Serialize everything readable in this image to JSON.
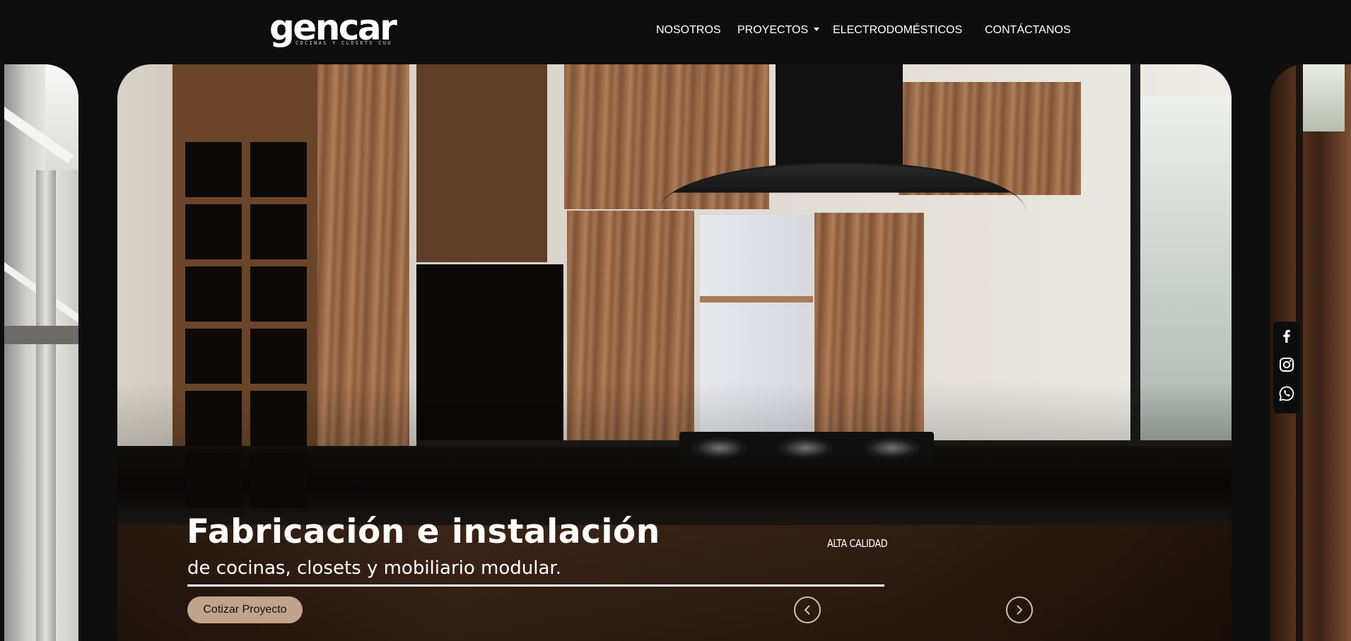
{
  "brand": {
    "logo_text": "gencar",
    "logo_tagline": "COCINAS Y CLOSETS CUU"
  },
  "nav": {
    "items": [
      {
        "label": "NOSOTROS"
      },
      {
        "label": "PROYECTOS",
        "has_dropdown": true
      },
      {
        "label": "ELECTRODOMÉSTICOS"
      },
      {
        "label": "CONTÁCTANOS"
      }
    ]
  },
  "hero": {
    "title": "Fabricación e instalación",
    "subtitle": "de cocinas, closets y mobiliario modular.",
    "cta_label": "Cotizar Proyecto",
    "badge": "ALTA CALIDAD",
    "prev_icon": "chevron-left-icon",
    "next_icon": "chevron-right-icon"
  },
  "social": {
    "items": [
      {
        "icon": "facebook-icon"
      },
      {
        "icon": "instagram-icon"
      },
      {
        "icon": "whatsapp-icon"
      }
    ]
  },
  "colors": {
    "page_bg": "#0e0e0e",
    "accent": "#c2a48c",
    "text": "#ffffff"
  }
}
